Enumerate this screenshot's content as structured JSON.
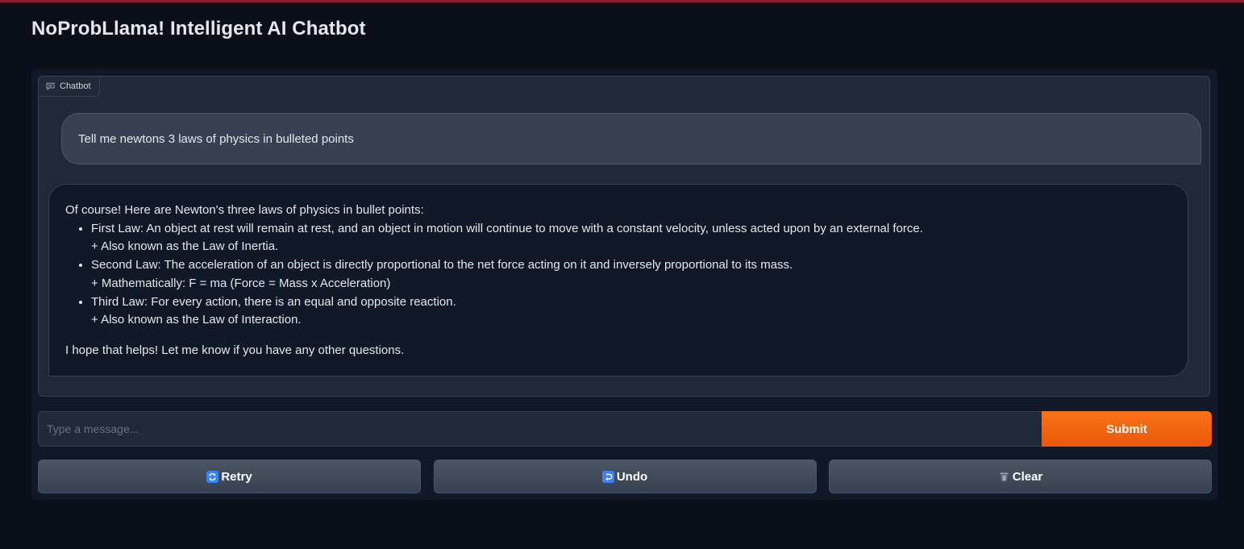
{
  "app": {
    "title": "NoProbLlama! Intelligent AI Chatbot",
    "accent_color": "#8b1c2c",
    "submit_color": "#f97316"
  },
  "chatbot": {
    "label": "Chatbot",
    "label_icon": "chat-bubble-icon",
    "messages": [
      {
        "role": "user",
        "text": "Tell me newtons 3 laws of physics in bulleted points"
      },
      {
        "role": "bot",
        "intro": "Of course! Here are Newton's three laws of physics in bullet points:",
        "bullets": [
          {
            "text": "First Law: An object at rest will remain at rest, and an object in motion will continue to move with a constant velocity, unless acted upon by an external force.",
            "sub": "+ Also known as the Law of Inertia."
          },
          {
            "text": "Second Law: The acceleration of an object is directly proportional to the net force acting on it and inversely proportional to its mass.",
            "sub": "+ Mathematically: F = ma (Force = Mass x Acceleration)"
          },
          {
            "text": "Third Law: For every action, there is an equal and opposite reaction.",
            "sub": "+ Also known as the Law of Interaction."
          }
        ],
        "outro": "I hope that helps! Let me know if you have any other questions."
      }
    ]
  },
  "input": {
    "placeholder": "Type a message...",
    "value": "",
    "submit_label": "Submit"
  },
  "actions": [
    {
      "label": "Retry",
      "icon": "retry-icon"
    },
    {
      "label": "Undo",
      "icon": "undo-icon"
    },
    {
      "label": "Clear",
      "icon": "trash-icon"
    }
  ]
}
